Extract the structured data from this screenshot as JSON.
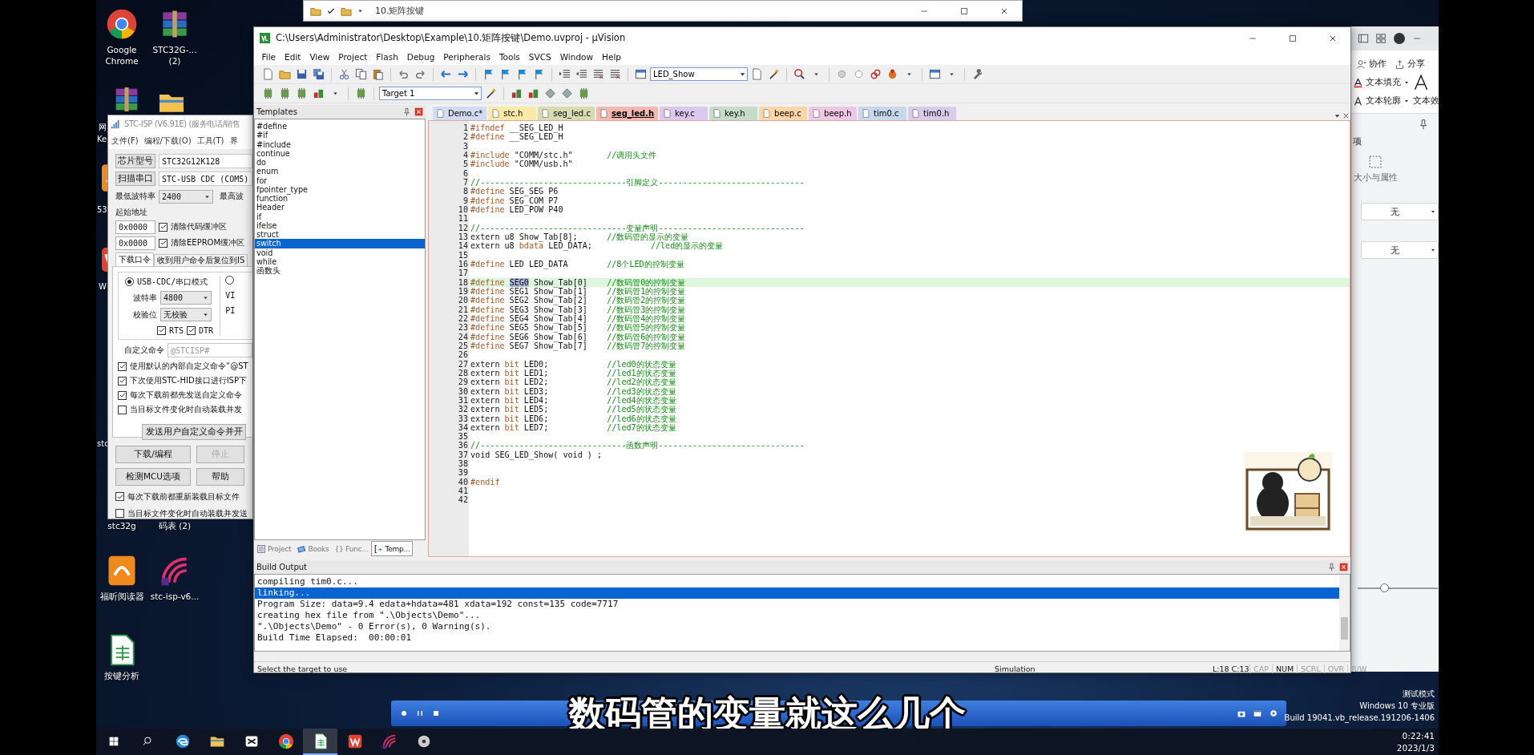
{
  "explorer_window": {
    "title": "10.矩阵按键"
  },
  "desktop": {
    "icons": [
      {
        "kind": "chrome",
        "label": "Google Chrome"
      },
      {
        "kind": "archive",
        "label": "STC32G-... (2)"
      },
      {
        "kind": "covered",
        "label": "stc32g"
      },
      {
        "kind": "covered",
        "label": "码表 (2)"
      },
      {
        "kind": "pdf",
        "label": "福昕阅读器"
      },
      {
        "kind": "isp",
        "label": "stc-isp-v6..."
      },
      {
        "kind": "sheet",
        "label": "按键分析"
      }
    ],
    "fragments": [
      "网",
      "Ke",
      "53",
      "W",
      "stc"
    ]
  },
  "isp": {
    "title": "STC-ISP (V6.91E) (服务电话/销售",
    "menu": [
      "文件(F)",
      "编程/下载(O)",
      "工具(T)",
      "界"
    ],
    "chip_button": "芯片型号",
    "chip": "STC32G12K128",
    "scan_button": "扫描串口",
    "port": "STC-USB CDC (COM5)",
    "min_baud_label": "最低波特率",
    "min_baud": "2400",
    "max_baud_label": "最高波",
    "start_label": "起始地址",
    "address_rows": [
      {
        "address": "0x0000",
        "label": "清除代码缓冲区",
        "checked": true
      },
      {
        "address": "0x0000",
        "label": "清除EEPROM缓冲区",
        "checked": true
      }
    ],
    "tabs": [
      {
        "label": "下载口令",
        "selected": true
      },
      {
        "label": "收到用户命令后复位到IS",
        "selected": false
      }
    ],
    "modes": [
      {
        "label": "USB-CDC/串口模式",
        "selected": true
      },
      {
        "selected": false
      }
    ],
    "baud_label": "波特率",
    "baud": "4800",
    "parity_label": "校验位",
    "parity": "无校验",
    "lines": [
      {
        "label": "RTS",
        "checked": true
      },
      {
        "label": "DTR",
        "checked": true
      }
    ],
    "right_labels": [
      "VI",
      "PI"
    ],
    "custom_label": "自定义命令",
    "custom_value": "@STCISP#",
    "options": [
      {
        "label": "使用默认的内部自定义命令“@ST",
        "checked": true
      },
      {
        "label": "下次使用STC-HID接口进行ISP下",
        "checked": true
      },
      {
        "label": "每次下载前都先发送自定义命令",
        "checked": true
      },
      {
        "label": "当目标文件变化时自动装载并发",
        "checked": false
      }
    ],
    "send_button": "发送用户自定义命令并开",
    "buttons": [
      {
        "label": "下载/编程",
        "disabled": false
      },
      {
        "label": "停止",
        "disabled": true
      },
      {
        "label": "检测MCU选项",
        "disabled": false
      },
      {
        "label": "帮助",
        "disabled": false
      }
    ],
    "bottom_options": [
      {
        "label": "每次下载前都重新装载目标文件",
        "checked": true
      },
      {
        "label": "当目标文件变化时自动装载并发送",
        "checked": false
      }
    ]
  },
  "uvision": {
    "title": "C:\\Users\\Administrator\\Desktop\\Example\\10.矩阵按键\\Demo.uvproj - µVision",
    "menu": [
      "File",
      "Edit",
      "View",
      "Project",
      "Flash",
      "Debug",
      "Peripherals",
      "Tools",
      "SVCS",
      "Window",
      "Help"
    ],
    "function_dropdown": "LED_Show",
    "target_dropdown": "Target 1",
    "templates": {
      "title": "Templates",
      "items": [
        {
          "label": "#define",
          "selected": false
        },
        {
          "label": "#if",
          "selected": false
        },
        {
          "label": "#include",
          "selected": false
        },
        {
          "label": "continue",
          "selected": false
        },
        {
          "label": "do",
          "selected": false
        },
        {
          "label": "enum",
          "selected": false
        },
        {
          "label": "for",
          "selected": false
        },
        {
          "label": "fpointer_type",
          "selected": false
        },
        {
          "label": "function",
          "selected": false
        },
        {
          "label": "Header",
          "selected": false
        },
        {
          "label": "if",
          "selected": false
        },
        {
          "label": "ifelse",
          "selected": false
        },
        {
          "label": "struct",
          "selected": false
        },
        {
          "label": "switch",
          "selected": true
        },
        {
          "label": "void",
          "selected": false
        },
        {
          "label": "while",
          "selected": false
        },
        {
          "label": "函数头",
          "selected": false
        }
      ],
      "tabs": [
        {
          "kind": "project",
          "label": "Project",
          "selected": false
        },
        {
          "kind": "books",
          "label": "Books",
          "selected": false
        },
        {
          "kind": "functions",
          "label": "{} Func...",
          "selected": false
        },
        {
          "kind": "templates",
          "label": "Temp...",
          "selected": true
        }
      ]
    },
    "file_tabs": [
      {
        "label": "Demo.c*",
        "color": "#d2dbf0",
        "selected": false
      },
      {
        "label": "stc.h",
        "color": "#fbe9a8",
        "selected": false
      },
      {
        "label": "seg_led.c",
        "color": "#d6dcb0",
        "selected": false
      },
      {
        "label": "seg_led.h",
        "color": "#f4b8b0",
        "selected": true
      },
      {
        "label": "key.c",
        "color": "#dcc8ec",
        "selected": false
      },
      {
        "label": "key.h",
        "color": "#c4dcc8",
        "selected": false
      },
      {
        "label": "beep.c",
        "color": "#fad6a8",
        "selected": false
      },
      {
        "label": "beep.h",
        "color": "#ecc8e4",
        "selected": false
      },
      {
        "label": "tim0.c",
        "color": "#c8d8ec",
        "selected": false
      },
      {
        "label": "tim0.h",
        "color": "#d8cce8",
        "selected": false
      }
    ],
    "code_lines": [
      {
        "number": "1",
        "current": false,
        "segments": [
          {
            "kind": "keyword",
            "text": "#ifndef"
          },
          {
            "kind": "plain",
            "text": " __SEG_LED_H"
          }
        ]
      },
      {
        "number": "2",
        "current": false,
        "segments": [
          {
            "kind": "keyword",
            "text": "#define"
          },
          {
            "kind": "plain",
            "text": " __SEG_LED_H"
          }
        ]
      },
      {
        "number": "3",
        "current": false
      },
      {
        "number": "4",
        "current": false,
        "segments": [
          {
            "kind": "keyword",
            "text": "#include"
          },
          {
            "kind": "plain",
            "text": " \"COMM/stc.h\"       "
          },
          {
            "kind": "comment",
            "text": "//调用头文件"
          }
        ]
      },
      {
        "number": "5",
        "current": false,
        "segments": [
          {
            "kind": "keyword",
            "text": "#include"
          },
          {
            "kind": "plain",
            "text": " \"COMM/usb.h\""
          }
        ]
      },
      {
        "number": "6",
        "current": false
      },
      {
        "number": "7",
        "current": false,
        "segments": [
          {
            "kind": "comment",
            "text": "//------------------------------引脚定义------------------------------"
          }
        ]
      },
      {
        "number": "8",
        "current": false,
        "segments": [
          {
            "kind": "keyword",
            "text": "#define"
          },
          {
            "kind": "plain",
            "text": " SEG_SEG P6"
          }
        ]
      },
      {
        "number": "9",
        "current": false,
        "segments": [
          {
            "kind": "keyword",
            "text": "#define"
          },
          {
            "kind": "plain",
            "text": " SEG_COM P7"
          }
        ]
      },
      {
        "number": "10",
        "current": false,
        "segments": [
          {
            "kind": "keyword",
            "text": "#define"
          },
          {
            "kind": "plain",
            "text": " LED_POW P40"
          }
        ]
      },
      {
        "number": "11",
        "current": false
      },
      {
        "number": "12",
        "current": false,
        "segments": [
          {
            "kind": "comment",
            "text": "//------------------------------变量声明------------------------------"
          }
        ]
      },
      {
        "number": "13",
        "current": false,
        "segments": [
          {
            "kind": "plain",
            "text": "extern u8 Show_Tab[8];      "
          },
          {
            "kind": "comment",
            "text": "//数码管的显示的变量"
          }
        ]
      },
      {
        "number": "14",
        "current": false,
        "segments": [
          {
            "kind": "plain",
            "text": "extern u8 "
          },
          {
            "kind": "keyword",
            "text": "bdata"
          },
          {
            "kind": "plain",
            "text": " LED_DATA;            "
          },
          {
            "kind": "comment",
            "text": "//led的显示的变量"
          }
        ]
      },
      {
        "number": "15",
        "current": false
      },
      {
        "number": "16",
        "current": false,
        "segments": [
          {
            "kind": "keyword",
            "text": "#define"
          },
          {
            "kind": "plain",
            "text": " LED LED_DATA        "
          },
          {
            "kind": "comment",
            "text": "//8个LED的控制变量"
          }
        ]
      },
      {
        "number": "17",
        "current": false
      },
      {
        "number": "18",
        "current": true,
        "segments": [
          {
            "kind": "keyword",
            "text": "#define "
          },
          {
            "kind": "selection",
            "text": "SEG0"
          },
          {
            "kind": "plain",
            "text": " Show_Tab[0]    "
          },
          {
            "kind": "comment",
            "text": "//数码管0的控制变量"
          }
        ]
      },
      {
        "number": "19",
        "current": false,
        "segments": [
          {
            "kind": "keyword",
            "text": "#define"
          },
          {
            "kind": "plain",
            "text": " SEG1 Show_Tab[1]    "
          },
          {
            "kind": "comment",
            "text": "//数码管1的控制变量"
          }
        ]
      },
      {
        "number": "20",
        "current": false,
        "segments": [
          {
            "kind": "keyword",
            "text": "#define"
          },
          {
            "kind": "plain",
            "text": " SEG2 Show_Tab[2]    "
          },
          {
            "kind": "comment",
            "text": "//数码管2的控制变量"
          }
        ]
      },
      {
        "number": "21",
        "current": false,
        "segments": [
          {
            "kind": "keyword",
            "text": "#define"
          },
          {
            "kind": "plain",
            "text": " SEG3 Show_Tab[3]    "
          },
          {
            "kind": "comment",
            "text": "//数码管3的控制变量"
          }
        ]
      },
      {
        "number": "22",
        "current": false,
        "segments": [
          {
            "kind": "keyword",
            "text": "#define"
          },
          {
            "kind": "plain",
            "text": " SEG4 Show_Tab[4]    "
          },
          {
            "kind": "comment",
            "text": "//数码管4的控制变量"
          }
        ]
      },
      {
        "number": "23",
        "current": false,
        "segments": [
          {
            "kind": "keyword",
            "text": "#define"
          },
          {
            "kind": "plain",
            "text": " SEG5 Show_Tab[5]    "
          },
          {
            "kind": "comment",
            "text": "//数码管5的控制变量"
          }
        ]
      },
      {
        "number": "24",
        "current": false,
        "segments": [
          {
            "kind": "keyword",
            "text": "#define"
          },
          {
            "kind": "plain",
            "text": " SEG6 Show_Tab[6]    "
          },
          {
            "kind": "comment",
            "text": "//数码管6的控制变量"
          }
        ]
      },
      {
        "number": "25",
        "current": false,
        "segments": [
          {
            "kind": "keyword",
            "text": "#define"
          },
          {
            "kind": "plain",
            "text": " SEG7 Show_Tab[7]    "
          },
          {
            "kind": "comment",
            "text": "//数码管7的控制变量"
          }
        ]
      },
      {
        "number": "26",
        "current": false
      },
      {
        "number": "27",
        "current": false,
        "segments": [
          {
            "kind": "plain",
            "text": "extern "
          },
          {
            "kind": "keyword",
            "text": "bit"
          },
          {
            "kind": "plain",
            "text": " LED0;            "
          },
          {
            "kind": "comment",
            "text": "//led0的状态变量"
          }
        ]
      },
      {
        "number": "28",
        "current": false,
        "segments": [
          {
            "kind": "plain",
            "text": "extern "
          },
          {
            "kind": "keyword",
            "text": "bit"
          },
          {
            "kind": "plain",
            "text": " LED1;            "
          },
          {
            "kind": "comment",
            "text": "//led1的状态变量"
          }
        ]
      },
      {
        "number": "29",
        "current": false,
        "segments": [
          {
            "kind": "plain",
            "text": "extern "
          },
          {
            "kind": "keyword",
            "text": "bit"
          },
          {
            "kind": "plain",
            "text": " LED2;            "
          },
          {
            "kind": "comment",
            "text": "//led2的状态变量"
          }
        ]
      },
      {
        "number": "30",
        "current": false,
        "segments": [
          {
            "kind": "plain",
            "text": "extern "
          },
          {
            "kind": "keyword",
            "text": "bit"
          },
          {
            "kind": "plain",
            "text": " LED3;            "
          },
          {
            "kind": "comment",
            "text": "//led3的状态变量"
          }
        ]
      },
      {
        "number": "31",
        "current": false,
        "segments": [
          {
            "kind": "plain",
            "text": "extern "
          },
          {
            "kind": "keyword",
            "text": "bit"
          },
          {
            "kind": "plain",
            "text": " LED4;            "
          },
          {
            "kind": "comment",
            "text": "//led4的状态变量"
          }
        ]
      },
      {
        "number": "32",
        "current": false,
        "segments": [
          {
            "kind": "plain",
            "text": "extern "
          },
          {
            "kind": "keyword",
            "text": "bit"
          },
          {
            "kind": "plain",
            "text": " LED5;            "
          },
          {
            "kind": "comment",
            "text": "//led5的状态变量"
          }
        ]
      },
      {
        "number": "33",
        "current": false,
        "segments": [
          {
            "kind": "plain",
            "text": "extern "
          },
          {
            "kind": "keyword",
            "text": "bit"
          },
          {
            "kind": "plain",
            "text": " LED6;            "
          },
          {
            "kind": "comment",
            "text": "//led6的状态变量"
          }
        ]
      },
      {
        "number": "34",
        "current": false,
        "segments": [
          {
            "kind": "plain",
            "text": "extern "
          },
          {
            "kind": "keyword",
            "text": "bit"
          },
          {
            "kind": "plain",
            "text": " LED7;            "
          },
          {
            "kind": "comment",
            "text": "//led7的状态变量"
          }
        ]
      },
      {
        "number": "35",
        "current": false
      },
      {
        "number": "36",
        "current": false,
        "segments": [
          {
            "kind": "comment",
            "text": "//------------------------------函数声明------------------------------"
          }
        ]
      },
      {
        "number": "37",
        "current": false,
        "segments": [
          {
            "kind": "plain",
            "text": "void SEG_LED_Show( void ) ;"
          }
        ]
      },
      {
        "number": "38",
        "current": false
      },
      {
        "number": "39",
        "current": false
      },
      {
        "number": "40",
        "current": false,
        "segments": [
          {
            "kind": "keyword",
            "text": "#endif"
          }
        ]
      },
      {
        "number": "41",
        "current": false
      },
      {
        "number": "42",
        "current": false
      }
    ],
    "build_output": {
      "title": "Build Output",
      "lines": [
        {
          "text": "compiling tim0.c...",
          "selected": false
        },
        {
          "text": "linking...",
          "selected": true
        },
        {
          "text": "Program Size: data=9.4 edata+hdata=481 xdata=192 const=135 code=7717",
          "selected": false
        },
        {
          "text": "creating hex file from \".\\Objects\\Demo\"...",
          "selected": false
        },
        {
          "text": "\".\\Objects\\Demo\" - 0 Error(s), 0 Warning(s).",
          "selected": false
        },
        {
          "text": "Build Time Elapsed:  00:00:01",
          "selected": false
        }
      ]
    },
    "status_bar": {
      "message": "Select the target to use",
      "mode": "Simulation",
      "position": "L:18 C:13",
      "indicators": [
        {
          "label": "CAP",
          "on": false
        },
        {
          "label": "NUM",
          "on": true
        },
        {
          "label": "SCRL",
          "on": false
        },
        {
          "label": "OVR",
          "on": false
        },
        {
          "label": "R/W",
          "on": false
        }
      ]
    }
  },
  "wps": {
    "share_actions": [
      "协作",
      "分享"
    ],
    "text_tools": [
      "文本填充",
      "文本轮廓"
    ],
    "effect_label": "文本效",
    "panel_heading": "项",
    "size_tab": "大小与属性",
    "dropdowns": [
      "无",
      "无"
    ],
    "zoom_slider": {
      "level": 0.33
    }
  },
  "subtitle": "数码管的变量就这么几个",
  "desktop_notice": [
    "测试模式",
    "Windows 10 专业版",
    "Build 19041.vb_release.191206-1406"
  ],
  "taskbar": {
    "apps": [
      {
        "kind": "start",
        "active": false
      },
      {
        "kind": "search",
        "active": false
      },
      {
        "kind": "edge",
        "active": false
      },
      {
        "kind": "explorer",
        "active": false
      },
      {
        "kind": "capcut",
        "active": false
      },
      {
        "kind": "chrome",
        "active": false
      },
      {
        "kind": "sheet",
        "active": true
      },
      {
        "kind": "wps",
        "active": false
      },
      {
        "kind": "isp",
        "active": false
      },
      {
        "kind": "disc",
        "active": false
      }
    ],
    "time": "0:22:41",
    "date": "2023/1/3"
  }
}
